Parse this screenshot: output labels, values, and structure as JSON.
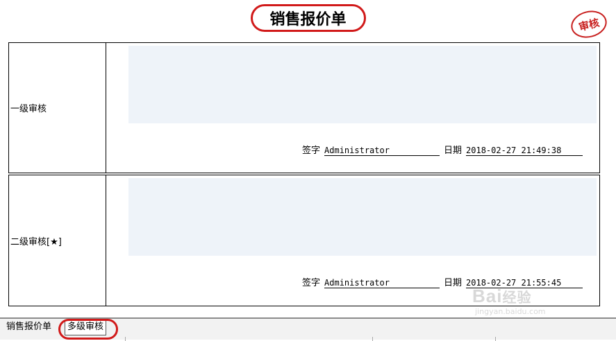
{
  "window": {
    "title": "销售报价单",
    "stamp_text": "审核"
  },
  "levels": [
    {
      "label": "一级审核",
      "signature_label": "签字",
      "signer": "Administrator",
      "date_label": "日期",
      "date": "2018-02-27 21:49:38"
    },
    {
      "label": "二级审核[★]",
      "signature_label": "签字",
      "signer": "Administrator",
      "date_label": "日期",
      "date": "2018-02-27 21:55:45"
    }
  ],
  "tabs": [
    {
      "label": "销售报价单",
      "active": false
    },
    {
      "label": "多级审核",
      "active": true
    }
  ],
  "watermark": {
    "brand_a": "Bai",
    "brand_b": "经验",
    "url": "jingyan.baidu.com"
  },
  "colors": {
    "highlight_ring": "#d11a1a",
    "comment_area": "#eef3f9"
  }
}
